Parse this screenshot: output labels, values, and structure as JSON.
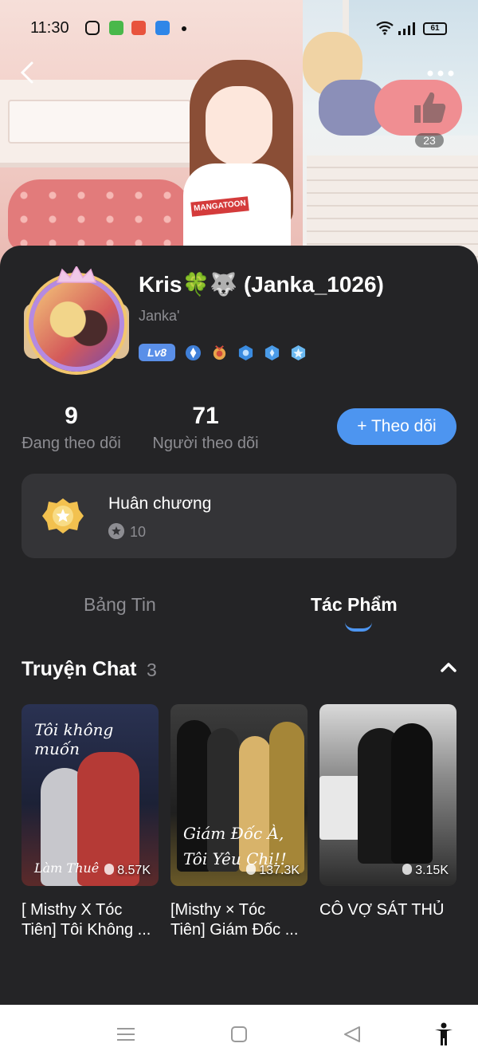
{
  "status_bar": {
    "time": "11:30",
    "battery": "61"
  },
  "header": {
    "like_count": "23"
  },
  "profile": {
    "name": "Kris🍀🐺 (Janka_1026)",
    "username": "Janka'",
    "level": "Lv8",
    "shirt_text": "MANGATOON"
  },
  "stats": {
    "following_count": "9",
    "following_label": "Đang theo dõi",
    "followers_count": "71",
    "followers_label": "Người theo dõi"
  },
  "follow_button": "+ Theo dõi",
  "medals": {
    "title": "Huân chương",
    "count": "10"
  },
  "tabs": [
    {
      "label": "Bảng Tin",
      "active": false
    },
    {
      "label": "Tác Phẩm",
      "active": true
    }
  ],
  "section": {
    "title": "Truyện Chat",
    "count": "3"
  },
  "stories": [
    {
      "cover_text": "Tôi không muốn",
      "cover_text_2": "Làm Thuê",
      "views": "8.57K",
      "title_line1": "[ Misthy X Tóc",
      "title_line2": "Tiên] Tôi Không ..."
    },
    {
      "cover_text": "Giám Đốc À,",
      "cover_text_2": "Tôi Yêu Chị!!",
      "views": "137.3K",
      "title_line1": "[Misthy × Tóc",
      "title_line2": "Tiên] Giám Đốc ..."
    },
    {
      "views": "3.15K",
      "title_line1": "CÔ VỢ SÁT THỦ",
      "title_line2": ""
    }
  ],
  "colors": {
    "card_bg": "#242426",
    "accent": "#4d95f0",
    "muted_text": "#8d8d92"
  }
}
